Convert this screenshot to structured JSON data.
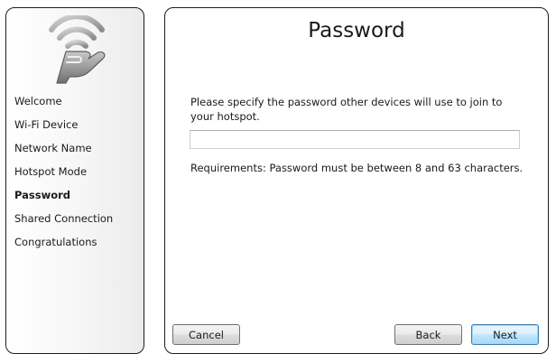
{
  "app": {
    "logo_icon": "wifi-hand-logo-icon"
  },
  "sidebar": {
    "items": [
      {
        "label": "Welcome",
        "active": false
      },
      {
        "label": "Wi-Fi Device",
        "active": false
      },
      {
        "label": "Network Name",
        "active": false
      },
      {
        "label": "Hotspot Mode",
        "active": false
      },
      {
        "label": "Password",
        "active": true
      },
      {
        "label": "Shared Connection",
        "active": false
      },
      {
        "label": "Congratulations",
        "active": false
      }
    ]
  },
  "main": {
    "title": "Password",
    "prompt": "Please specify the password other devices will use to join to your hotspot.",
    "password_value": "",
    "requirements": "Requirements: Password must be between 8 and 63 characters."
  },
  "buttons": {
    "cancel": "Cancel",
    "back": "Back",
    "next": "Next"
  },
  "colors": {
    "panel_border": "#1c1c1c",
    "default_button_border": "#3c7fb1",
    "default_button_fill": "#bee6fd"
  }
}
